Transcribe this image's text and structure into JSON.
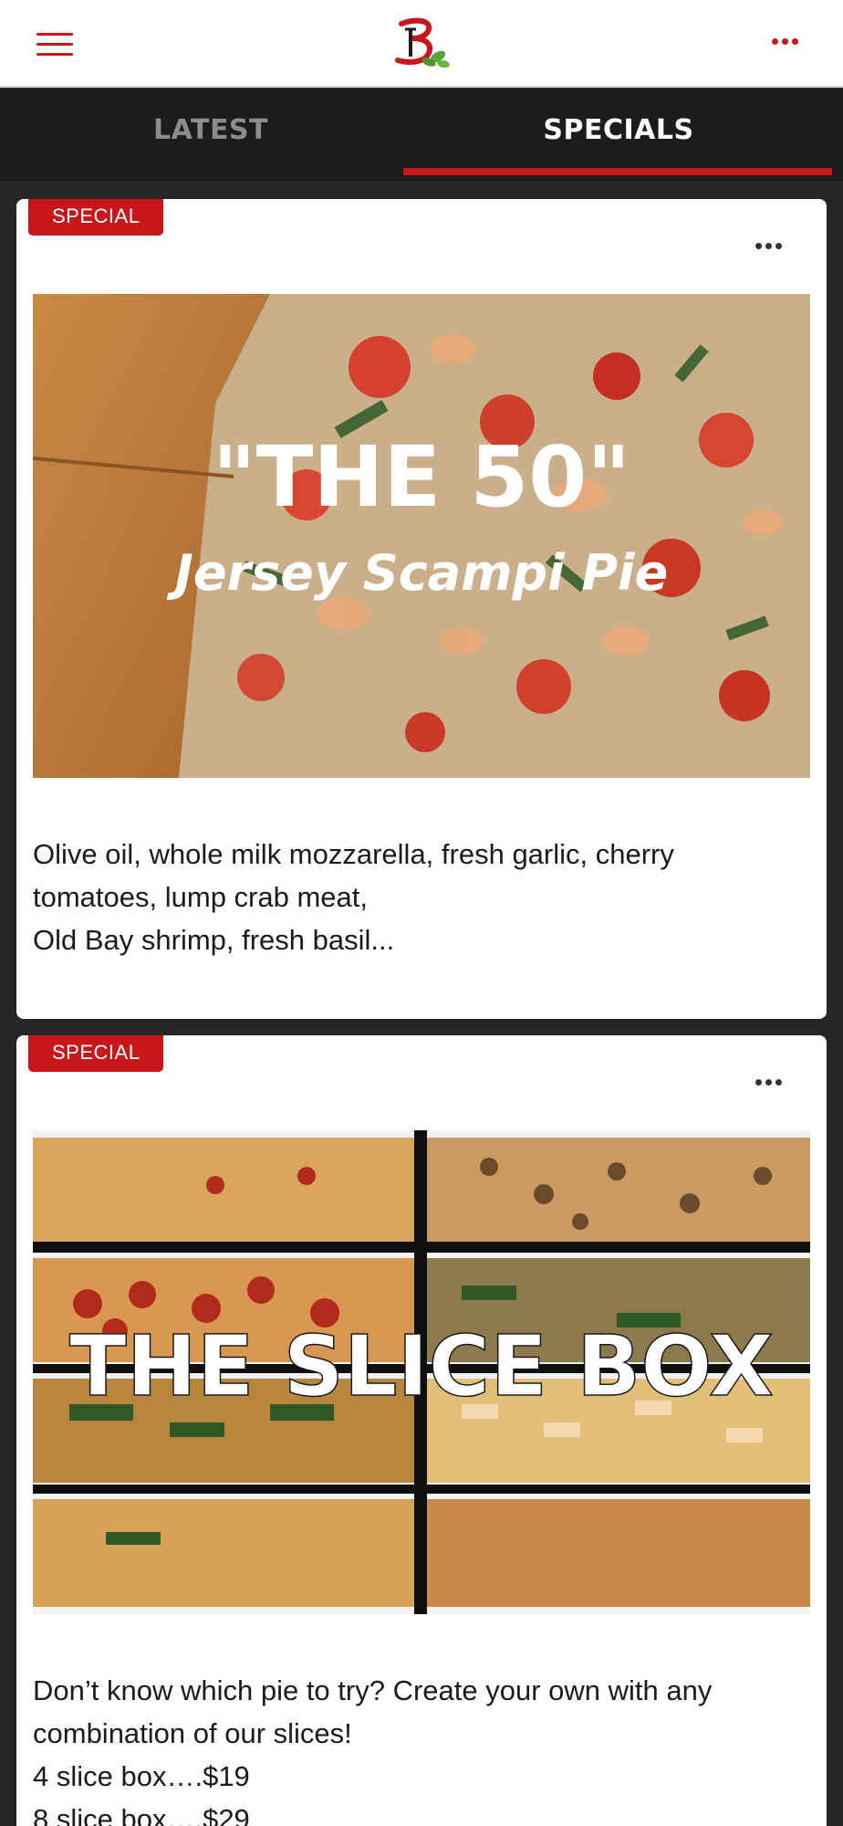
{
  "header": {
    "menu_icon": "hamburger-menu-icon",
    "logo_icon": "brand-logo-b-icon",
    "more_icon": "more-horizontal-icon",
    "accent_color": "#c8161b"
  },
  "tabs": [
    {
      "label": "LATEST",
      "selected": false
    },
    {
      "label": "SPECIALS",
      "selected": true
    }
  ],
  "posts": [
    {
      "badge": "SPECIAL",
      "image_title": "\"THE 50\"",
      "image_subtitle": "Jersey Scampi Pie",
      "description": "Olive oil, whole milk mozzarella, fresh garlic, cherry tomatoes, lump crab meat,\nOld Bay shrimp, fresh basil..."
    },
    {
      "badge": "SPECIAL",
      "image_title": "THE SLICE BOX",
      "description_lines": [
        "Don’t know which pie to try? Create your own with any combination of our slices!",
        "4 slice box….$19",
        "8 slice box….$29"
      ]
    }
  ]
}
